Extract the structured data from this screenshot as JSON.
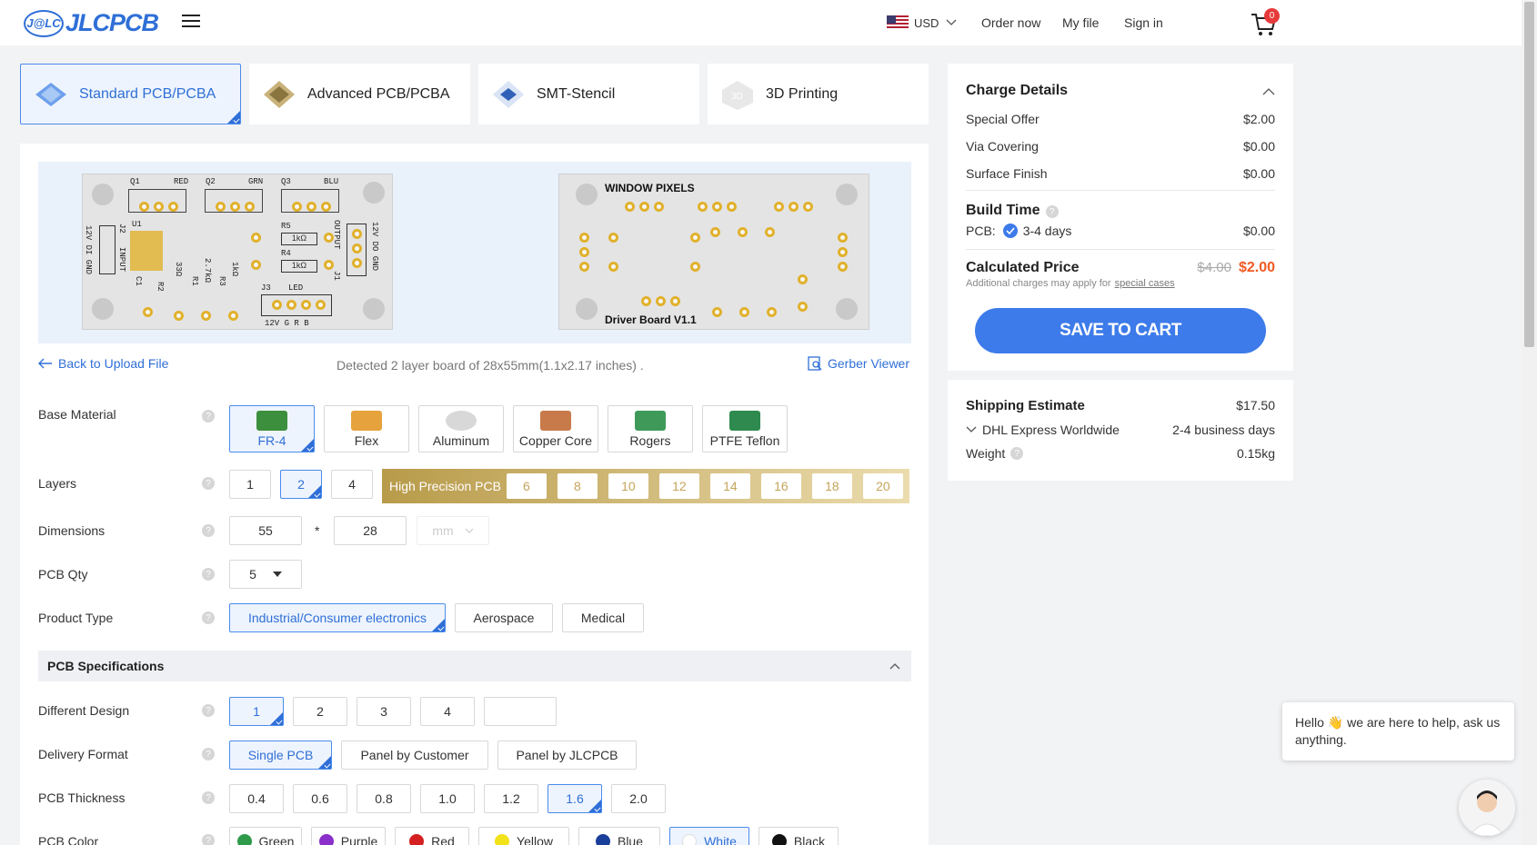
{
  "header": {
    "logo_badge": "J@LC",
    "logo_text": "JLCPCB",
    "currency": "USD",
    "order_now": "Order now",
    "my_file": "My file",
    "sign_in": "Sign in",
    "cart_count": "0"
  },
  "tabs": [
    {
      "label": "Standard PCB/PCBA",
      "active": true
    },
    {
      "label": "Advanced PCB/PCBA"
    },
    {
      "label": "SMT-Stencil"
    },
    {
      "label": "3D Printing"
    }
  ],
  "preview": {
    "front": {
      "q1": "Q1",
      "red": "RED",
      "q2": "Q2",
      "grn": "GRN",
      "q3": "Q3",
      "blu": "BLU",
      "u1": "U1",
      "r5": "R5",
      "r4": "R4",
      "r5_val": "1kΩ",
      "r4_val": "1kΩ",
      "output": "OUTPUT",
      "j1": "J1",
      "input": "INPUT",
      "j2": "J2",
      "j3": "J3",
      "led": "LED",
      "bottom": "12V G R B",
      "r2": "R2",
      "r1": "R1",
      "r3": "R3",
      "r2_val": "33Ω",
      "r1_val": "2.7kΩ",
      "r3_val": "1kΩ",
      "c1": "C1",
      "left_pins": "12V DI GND",
      "right_pins": "12V DO GND"
    },
    "back": {
      "title": "WINDOW PIXELS",
      "footer": "Driver Board V1.1"
    }
  },
  "links": {
    "back": "Back to Upload File",
    "detected": "Detected 2 layer board of 28x55mm(1.1x2.17 inches) .",
    "gerber": "Gerber Viewer"
  },
  "base_material": {
    "label": "Base Material",
    "options": [
      "FR-4",
      "Flex",
      "Aluminum",
      "Copper Core",
      "Rogers",
      "PTFE Teflon"
    ]
  },
  "layers": {
    "label": "Layers",
    "options": [
      "1",
      "2",
      "4"
    ],
    "high_precision": "High Precision PCB",
    "hp_options": [
      "6",
      "8",
      "10",
      "12",
      "14",
      "16",
      "18",
      "20"
    ]
  },
  "dimensions": {
    "label": "Dimensions",
    "length": "55",
    "width": "28",
    "times": "*",
    "unit": "mm"
  },
  "qty": {
    "label": "PCB Qty",
    "value": "5"
  },
  "product_type": {
    "label": "Product Type",
    "options": [
      "Industrial/Consumer electronics",
      "Aerospace",
      "Medical"
    ]
  },
  "specs_title": "PCB Specifications",
  "design": {
    "label": "Different Design",
    "options": [
      "1",
      "2",
      "3",
      "4"
    ]
  },
  "delivery": {
    "label": "Delivery Format",
    "options": [
      "Single PCB",
      "Panel by Customer",
      "Panel by JLCPCB"
    ]
  },
  "thickness": {
    "label": "PCB Thickness",
    "options": [
      "0.4",
      "0.6",
      "0.8",
      "1.0",
      "1.2",
      "1.6",
      "2.0"
    ]
  },
  "color": {
    "label": "PCB Color",
    "options": [
      {
        "name": "Green",
        "hex": "#2e9a4a"
      },
      {
        "name": "Purple",
        "hex": "#8a2fc9"
      },
      {
        "name": "Red",
        "hex": "#d42020"
      },
      {
        "name": "Yellow",
        "hex": "#f2e21a"
      },
      {
        "name": "Blue",
        "hex": "#1a3f9a"
      },
      {
        "name": "White",
        "hex": "#ffffff"
      },
      {
        "name": "Black",
        "hex": "#111111"
      }
    ]
  },
  "charge": {
    "title": "Charge Details",
    "special_offer": "Special Offer",
    "special_offer_val": "$2.00",
    "via": "Via Covering",
    "via_val": "$0.00",
    "finish": "Surface Finish",
    "finish_val": "$0.00",
    "build_time": "Build Time",
    "pcb": "PCB:",
    "days": "3-4 days",
    "days_val": "$0.00",
    "calc": "Calculated Price",
    "old_price": "$4.00",
    "price": "$2.00",
    "note": "Additional charges may apply for",
    "note_link": "special cases",
    "save": "SAVE TO CART"
  },
  "shipping": {
    "title": "Shipping Estimate",
    "price": "$17.50",
    "method": "DHL Express Worldwide",
    "days": "2-4 business days",
    "weight": "Weight",
    "weight_val": "0.15kg"
  },
  "chat": {
    "greeting": "Hello 👋 we are here to help, ask us anything."
  }
}
